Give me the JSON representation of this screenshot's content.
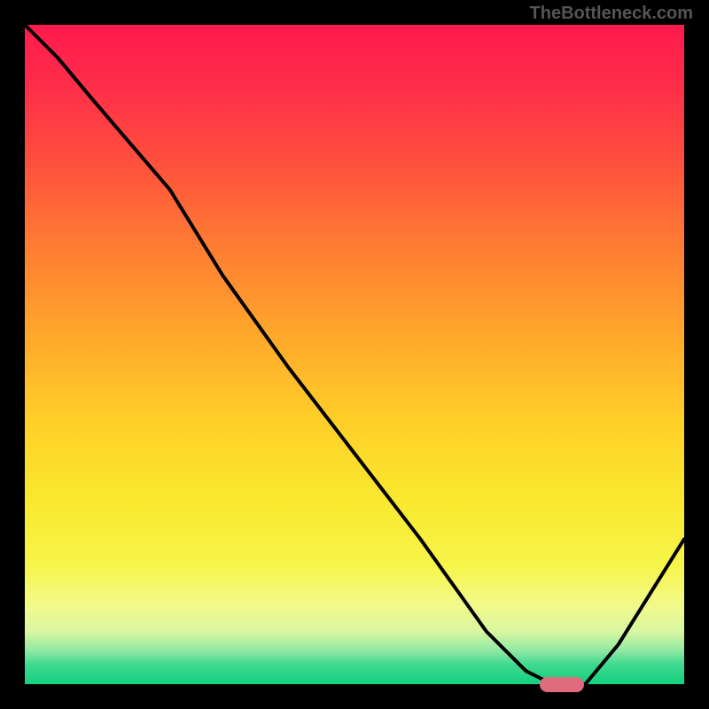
{
  "watermark": "TheBottleneck.com",
  "chart_data": {
    "type": "line",
    "title": "",
    "xlabel": "",
    "ylabel": "",
    "x": [
      0.0,
      0.05,
      0.1,
      0.16,
      0.22,
      0.3,
      0.4,
      0.5,
      0.6,
      0.7,
      0.76,
      0.8,
      0.83,
      0.85,
      0.9,
      0.95,
      1.0
    ],
    "values": [
      1.0,
      0.95,
      0.89,
      0.82,
      0.75,
      0.62,
      0.48,
      0.35,
      0.22,
      0.08,
      0.02,
      0.0,
      0.0,
      0.0,
      0.06,
      0.14,
      0.22
    ],
    "ylim": [
      0,
      1
    ],
    "xlim": [
      0,
      1
    ],
    "background_gradient": {
      "top": "#ff1a4d",
      "mid": "#ffd633",
      "bottom": "#14d07e"
    },
    "marker": {
      "x_center": 0.815,
      "y": 0.0,
      "color": "#e06b7d",
      "shape": "rounded-bar"
    },
    "annotations": []
  }
}
